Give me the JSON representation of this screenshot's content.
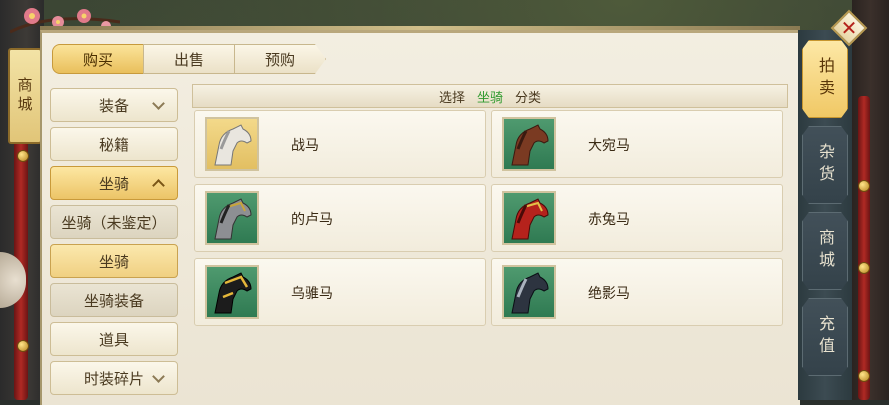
{
  "side_badge": "商城",
  "tabs": [
    {
      "label": "购买",
      "active": true
    },
    {
      "label": "出售",
      "active": false
    },
    {
      "label": "预购",
      "active": false
    }
  ],
  "menu": {
    "items": [
      {
        "label": "装备"
      },
      {
        "label": "秘籍"
      },
      {
        "label": "坐骑"
      },
      {
        "label": "坐骑（未鉴定）"
      },
      {
        "label": "坐骑"
      },
      {
        "label": "坐骑装备"
      },
      {
        "label": "道具"
      },
      {
        "label": "时装碎片"
      }
    ]
  },
  "filter": {
    "prefix": "选择",
    "selected": "坐骑",
    "suffix": "分类",
    "selected_color": "#2f9a2e"
  },
  "items": [
    {
      "name": "战马",
      "icon": "white-horse-icon"
    },
    {
      "name": "大宛马",
      "icon": "brown-horse-icon"
    },
    {
      "name": "的卢马",
      "icon": "grey-armored-horse-icon"
    },
    {
      "name": "赤兔马",
      "icon": "red-horse-icon"
    },
    {
      "name": "乌骓马",
      "icon": "black-gold-horse-icon"
    },
    {
      "name": "绝影马",
      "icon": "dark-horse-icon"
    }
  ],
  "rail": {
    "tabs": [
      {
        "label": "拍卖",
        "active": true
      },
      {
        "label": "杂货",
        "active": false
      },
      {
        "label": "商城",
        "active": false
      },
      {
        "label": "充值",
        "active": false
      }
    ]
  },
  "colors": {
    "accent_gold": "#f0c865",
    "panel_bg": "#f3eee1",
    "rope_red": "#b02a24"
  }
}
